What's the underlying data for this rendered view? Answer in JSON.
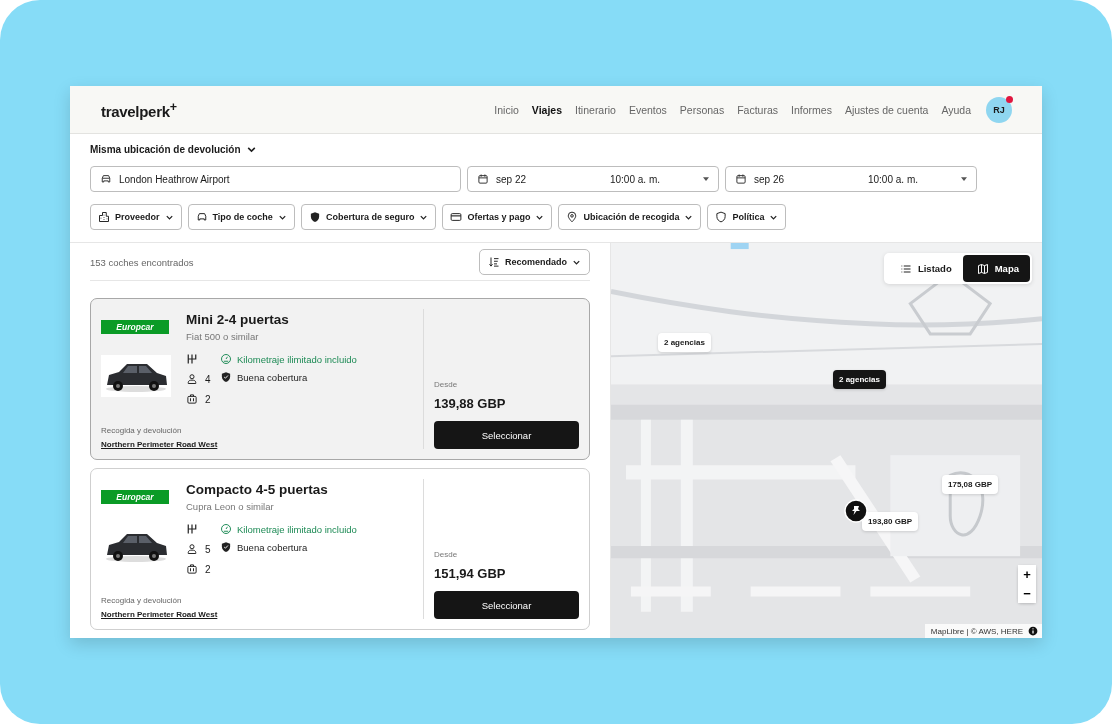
{
  "header": {
    "logo": "travelperk$^{+}$",
    "nav": [
      {
        "label": "Inicio",
        "selected": false
      },
      {
        "label": "Viajes",
        "selected": true
      },
      {
        "label": "Itinerario",
        "selected": false
      },
      {
        "label": "Eventos",
        "selected": false
      },
      {
        "label": "Personas",
        "selected": false
      },
      {
        "label": "Facturas",
        "selected": false
      },
      {
        "label": "Informes",
        "selected": false
      },
      {
        "label": "Ajustes de cuenta",
        "selected": false
      },
      {
        "label": "Ayuda",
        "selected": false
      }
    ],
    "avatar": {
      "initials": "RJ",
      "notification": true
    }
  },
  "search": {
    "return_option": "Misma ubicación de devolución",
    "location": "London Heathrow Airport",
    "pickup": {
      "date": "sep 22",
      "time": "10:00 a. m."
    },
    "dropoff": {
      "date": "sep 26",
      "time": "10:00 a. m."
    },
    "filters": [
      "Proveedor",
      "Tipo de coche",
      "Cobertura de seguro",
      "Ofertas y pago",
      "Ubicación de recogida",
      "Política"
    ]
  },
  "results": {
    "count": "153 coches encontrados",
    "sort": "Recomendado",
    "cars": [
      {
        "selected": true,
        "provider": "Europcar",
        "title": "Mini 2-4 puertas",
        "model": "Fiat 500 o similar",
        "seats": "4",
        "bags": "2",
        "features": [
          {
            "kind": "mileage",
            "label": "Kilometraje ilimitado incluido"
          },
          {
            "kind": "coverage",
            "label": "Buena cobertura"
          }
        ],
        "pickup_label": "Recogida y devolución",
        "pickup_place": "Northern Perimeter Road West",
        "from_label": "Desde",
        "price": "139,88 GBP",
        "action": "Seleccionar"
      },
      {
        "selected": false,
        "provider": "Europcar",
        "title": "Compacto 4-5 puertas",
        "model": "Cupra Leon o similar",
        "seats": "5",
        "bags": "2",
        "features": [
          {
            "kind": "mileage",
            "label": "Kilometraje ilimitado incluido"
          },
          {
            "kind": "coverage",
            "label": "Buena cobertura"
          }
        ],
        "pickup_label": "Recogida y devolución",
        "pickup_place": "Northern Perimeter Road West",
        "from_label": "Desde",
        "price": "151,94 GBP",
        "action": "Seleccionar"
      }
    ]
  },
  "map": {
    "view_toggle": [
      {
        "label": "Listado",
        "selected": false
      },
      {
        "label": "Mapa",
        "selected": true
      }
    ],
    "markers": [
      {
        "label": "2 agencias",
        "selected": false
      },
      {
        "label": "2 agencias",
        "selected": true
      },
      {
        "label": "175,08 GBP",
        "selected": false
      },
      {
        "label": "193,80 GBP",
        "selected": false
      }
    ],
    "zoom_in": "+",
    "zoom_out": "−",
    "attribution": "MapLibre | © AWS, HERE"
  }
}
